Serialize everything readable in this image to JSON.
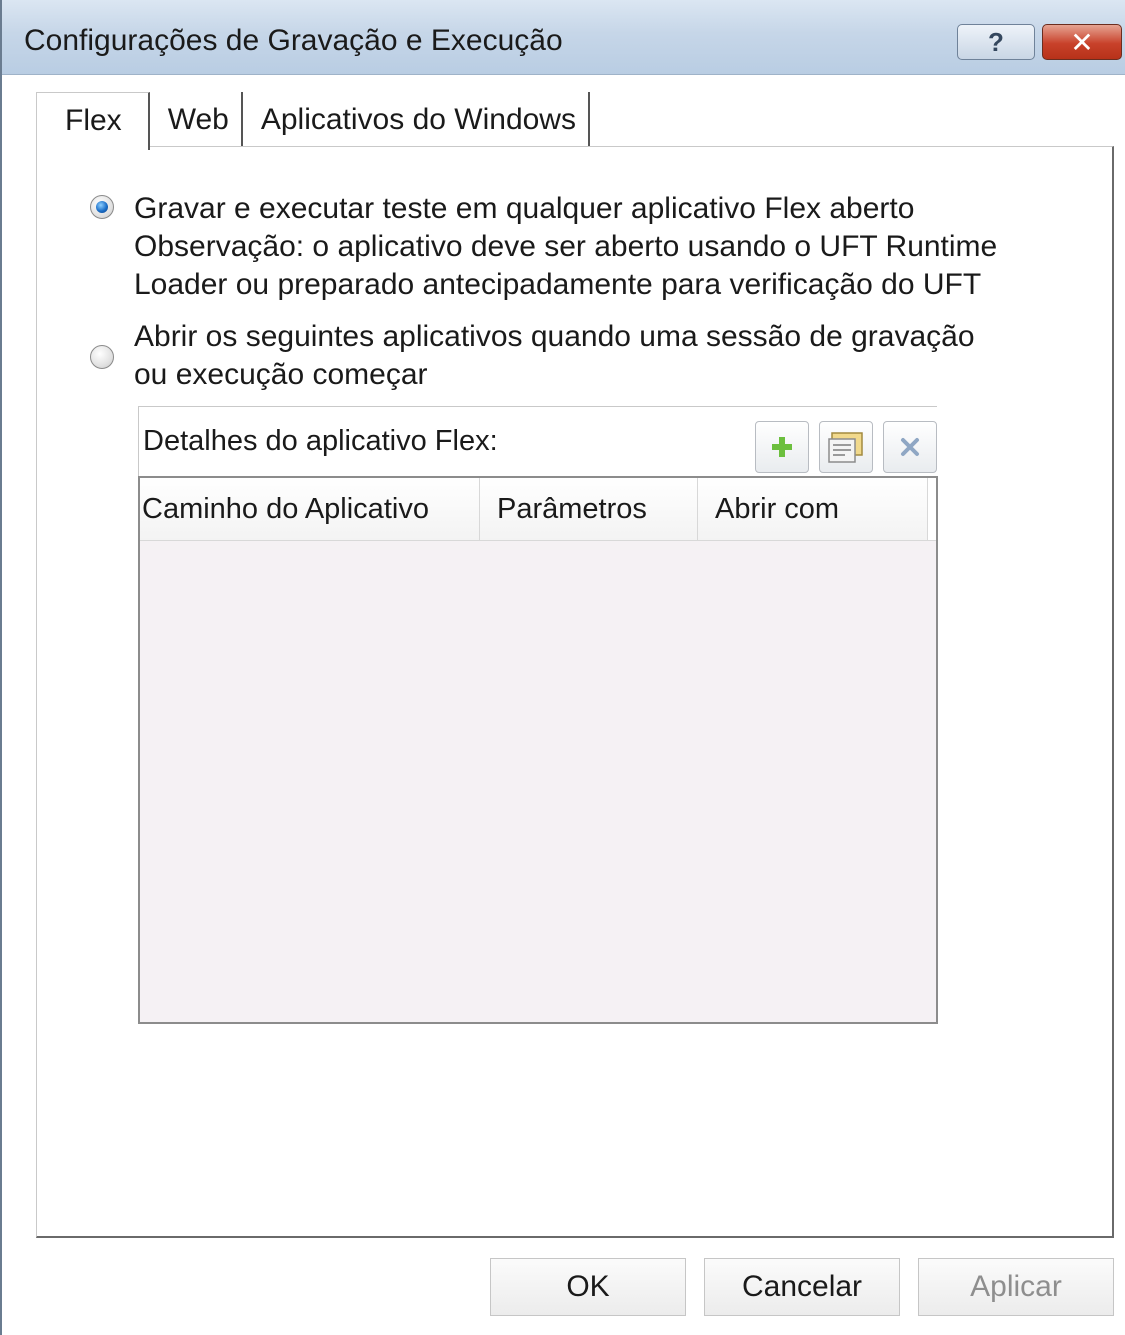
{
  "window": {
    "title": "Configurações de Gravação e Execução",
    "help_label": "?",
    "close_label": "✕"
  },
  "tabs": [
    {
      "label": "Flex",
      "active": true
    },
    {
      "label": "Web",
      "active": false
    },
    {
      "label": "Aplicativos do Windows",
      "active": false
    }
  ],
  "options": {
    "record_any": {
      "checked": true,
      "lines": [
        "Gravar e executar teste em qualquer aplicativo Flex aberto",
        "Observação: o aplicativo deve ser aberto usando o UFT Runtime",
        "Loader ou preparado antecipadamente para verificação do UFT"
      ]
    },
    "open_apps": {
      "checked": false,
      "lines": [
        "Abrir os seguintes aplicativos quando uma sessão de gravação",
        "ou execução começar"
      ]
    }
  },
  "details": {
    "title": "Detalhes do aplicativo Flex:",
    "toolbar": [
      {
        "icon": "add-icon"
      },
      {
        "icon": "edit-properties-icon"
      },
      {
        "icon": "delete-icon"
      }
    ],
    "columns": [
      "Caminho do Aplicativo",
      "Parâmetros",
      "Abrir com"
    ],
    "rows": []
  },
  "buttons": {
    "ok": "OK",
    "cancel": "Cancelar",
    "apply": "Aplicar",
    "apply_disabled": true
  },
  "colors": {
    "title_bar": "#c6d6e8",
    "close_button": "#c8412a",
    "radio_selected": "#1c6fc8",
    "grid_background": "#f5f1f4",
    "add_icon": "#6cbf3e",
    "delete_icon": "#8fa7c4"
  }
}
